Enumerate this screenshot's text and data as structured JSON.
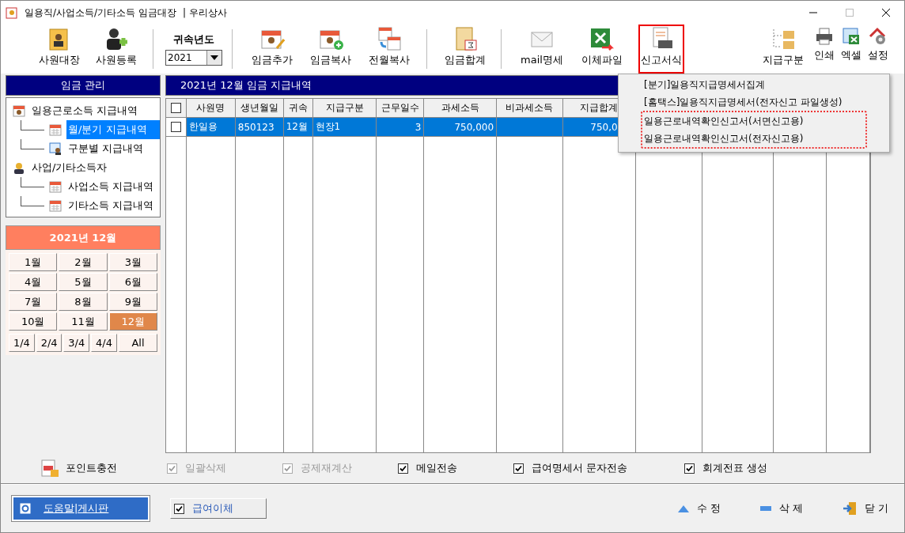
{
  "window": {
    "title": "일용직/사업소득/기타소득 임금대장",
    "company": "| 우리상사"
  },
  "toolbar": {
    "left": [
      {
        "label": "사원대장",
        "selected": false
      },
      {
        "label": "사원등록",
        "selected": false
      }
    ],
    "year": {
      "label": "귀속년도",
      "value": "2021"
    },
    "middle": [
      {
        "label": "임금추가",
        "selected": false
      },
      {
        "label": "임금복사",
        "selected": false
      },
      {
        "label": "전월복사",
        "selected": false
      }
    ],
    "sum": [
      {
        "label": "임금합계",
        "selected": false
      }
    ],
    "right": [
      {
        "label": "mail명세",
        "selected": false
      },
      {
        "label": "이체파일",
        "selected": false
      },
      {
        "label": "신고서식",
        "selected": true
      }
    ],
    "far": [
      {
        "label": "지급구분"
      }
    ],
    "small": [
      {
        "label": "인쇄"
      },
      {
        "label": "엑셀"
      },
      {
        "label": "설정"
      }
    ]
  },
  "report_menu": [
    {
      "label": "[분기]일용직지급명세서집계",
      "flagged": false
    },
    {
      "label": "[홈택스]일용직지급명세서(전자신고 파일생성)",
      "flagged": false
    },
    {
      "label": "일용근로내역확인신고서(서면신고용)",
      "flagged": true
    },
    {
      "label": "일용근로내역확인신고서(전자신고용)",
      "flagged": true
    }
  ],
  "sidebar": {
    "title": "임금 관리",
    "tree": [
      {
        "label": "일용근로소득 지급내역",
        "selected": false,
        "children": [
          {
            "label": "월/분기 지급내역",
            "selected": true
          },
          {
            "label": "구분별 지급내역",
            "selected": false
          }
        ]
      },
      {
        "label": "사업/기타소득자",
        "selected": false,
        "children": [
          {
            "label": "사업소득 지급내역",
            "selected": false
          },
          {
            "label": "기타소득 지급내역",
            "selected": false
          }
        ]
      }
    ]
  },
  "period": {
    "title": "2021년 12월",
    "months": [
      {
        "label": "1월",
        "selected": false
      },
      {
        "label": "2월",
        "selected": false
      },
      {
        "label": "3월",
        "selected": false
      },
      {
        "label": "4월",
        "selected": false
      },
      {
        "label": "5월",
        "selected": false
      },
      {
        "label": "6월",
        "selected": false
      },
      {
        "label": "7월",
        "selected": false
      },
      {
        "label": "8월",
        "selected": false
      },
      {
        "label": "9월",
        "selected": false
      },
      {
        "label": "10월",
        "selected": false
      },
      {
        "label": "11월",
        "selected": false
      },
      {
        "label": "12월",
        "selected": true
      }
    ],
    "quarters": [
      {
        "label": "1/4",
        "selected": false
      },
      {
        "label": "2/4",
        "selected": false
      },
      {
        "label": "3/4",
        "selected": false
      },
      {
        "label": "4/4",
        "selected": false
      },
      {
        "label": "All",
        "selected": false
      }
    ]
  },
  "table": {
    "title": "2021년 12월 임금 지급내역",
    "select_all": false,
    "columns": [
      "사원명",
      "생년월일",
      "귀속",
      "지급구분",
      "근무일수",
      "과세소득",
      "비과세소득",
      "지급합계"
    ],
    "rows": [
      {
        "checked": false,
        "selected": true,
        "cells": [
          "한일용",
          "850123",
          "12월",
          "현장1",
          "3",
          "750,000",
          "",
          "750,0"
        ]
      }
    ]
  },
  "options": {
    "point": "포인트충전",
    "checks": [
      {
        "label": "일괄삭제",
        "checked": true,
        "disabled": true
      },
      {
        "label": "공제재계산",
        "checked": true,
        "disabled": true
      },
      {
        "label": "메일전송",
        "checked": true,
        "disabled": false
      },
      {
        "label": "급여명세서 문자전송",
        "checked": true,
        "disabled": false
      },
      {
        "label": "회계전표 생성",
        "checked": true,
        "disabled": false
      }
    ]
  },
  "footer": {
    "help": "도움말|게시판",
    "transfer": {
      "label": "급여이체",
      "checked": true
    },
    "actions": [
      "수 정",
      "삭 제",
      "닫 기"
    ]
  }
}
